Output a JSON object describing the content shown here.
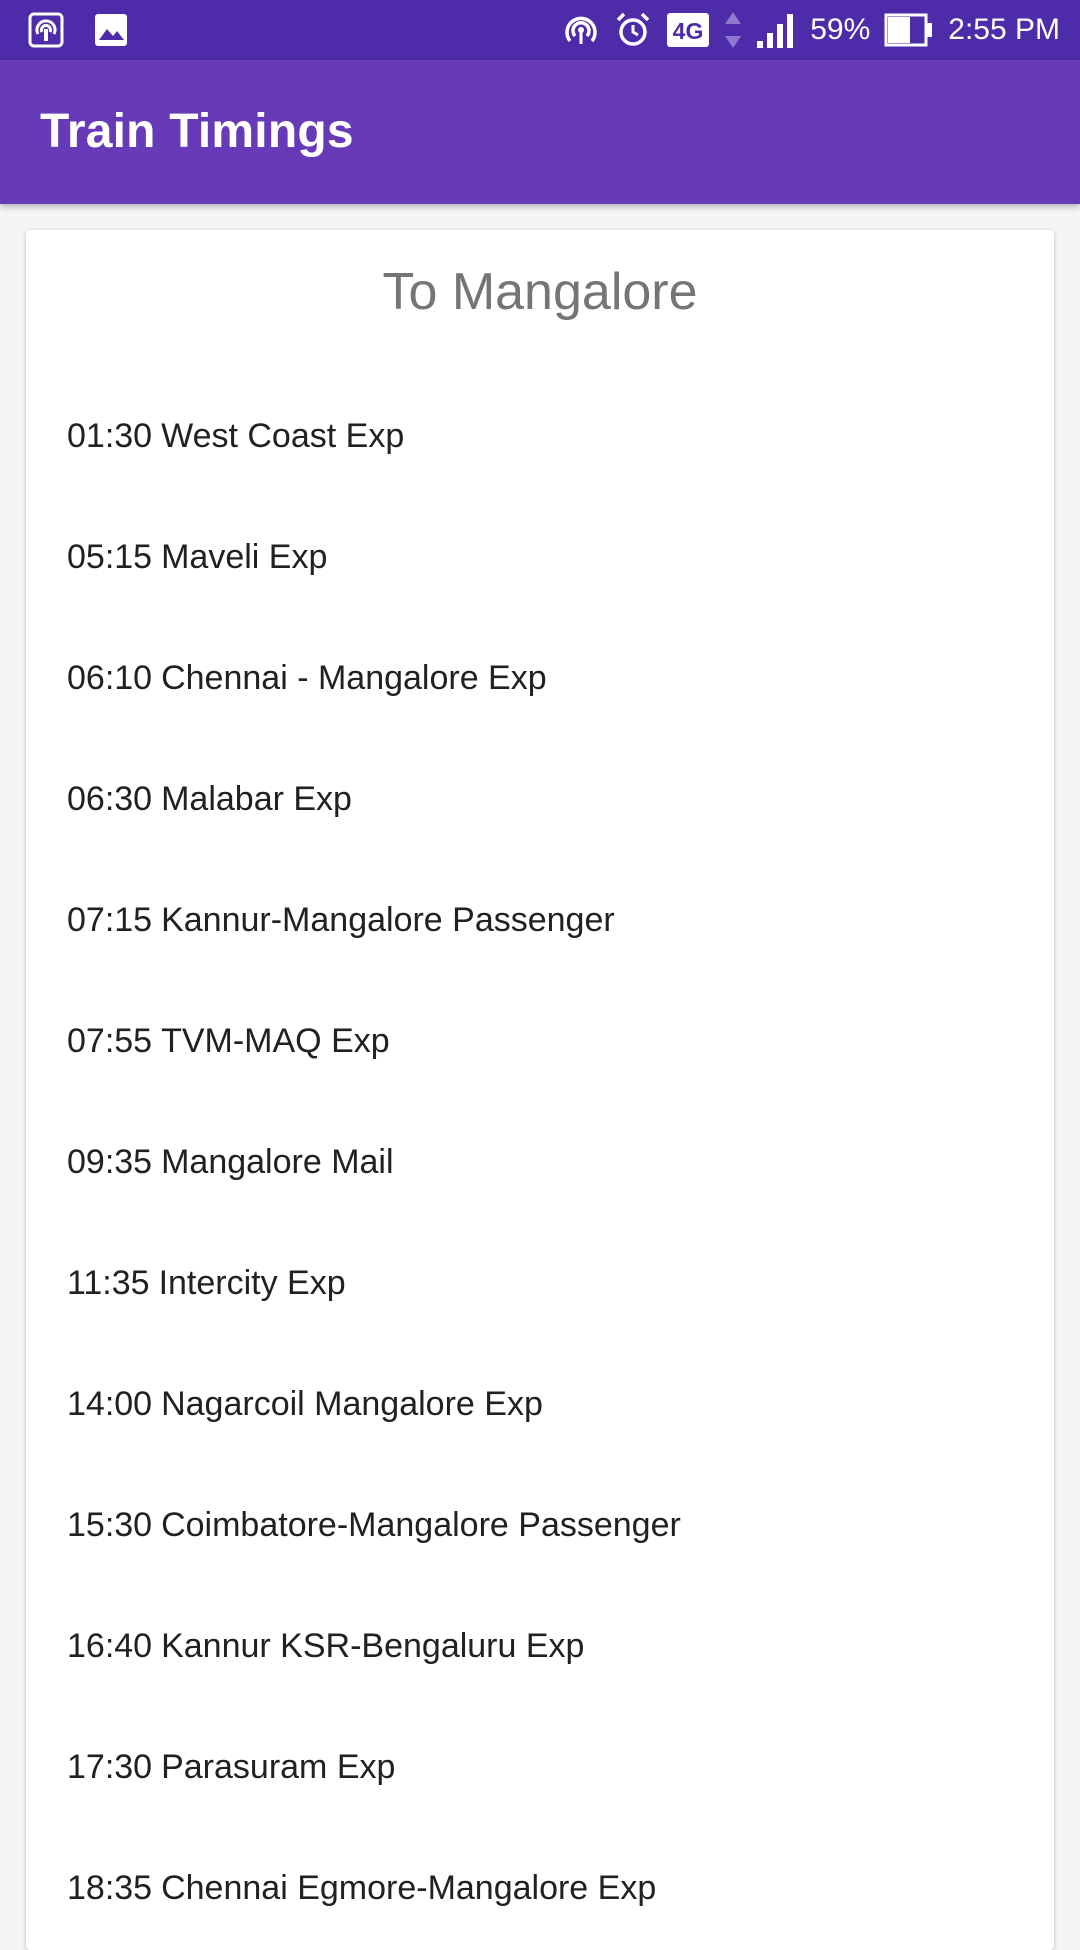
{
  "status_bar": {
    "battery_percent": "59%",
    "time": "2:55 PM",
    "network_type": "4G",
    "icons_left": [
      "hotspot-icon",
      "image-icon"
    ],
    "icons_right": [
      "hotspot-icon",
      "alarm-icon",
      "4g-icon",
      "data-arrows-icon",
      "signal-icon",
      "battery-icon"
    ],
    "colors": {
      "background": "#4e2ba8",
      "foreground": "#ffffff"
    }
  },
  "app_bar": {
    "title": "Train Timings",
    "color": "#673ab7"
  },
  "card": {
    "title": "To Mangalore",
    "trains": [
      {
        "time": "01:30",
        "name": "West Coast Exp"
      },
      {
        "time": "05:15",
        "name": "Maveli Exp"
      },
      {
        "time": "06:10",
        "name": "Chennai - Mangalore Exp"
      },
      {
        "time": "06:30",
        "name": "Malabar Exp"
      },
      {
        "time": "07:15",
        "name": "Kannur-Mangalore Passenger"
      },
      {
        "time": "07:55",
        "name": "TVM-MAQ Exp"
      },
      {
        "time": "09:35",
        "name": "Mangalore Mail"
      },
      {
        "time": "11:35",
        "name": "Intercity Exp"
      },
      {
        "time": "14:00",
        "name": "Nagarcoil Mangalore Exp"
      },
      {
        "time": "15:30",
        "name": "Coimbatore-Mangalore Passenger"
      },
      {
        "time": "16:40",
        "name": "Kannur KSR-Bengaluru Exp"
      },
      {
        "time": "17:30",
        "name": "Parasuram Exp"
      },
      {
        "time": "18:35",
        "name": "Chennai Egmore-Mangalore Exp"
      }
    ]
  }
}
